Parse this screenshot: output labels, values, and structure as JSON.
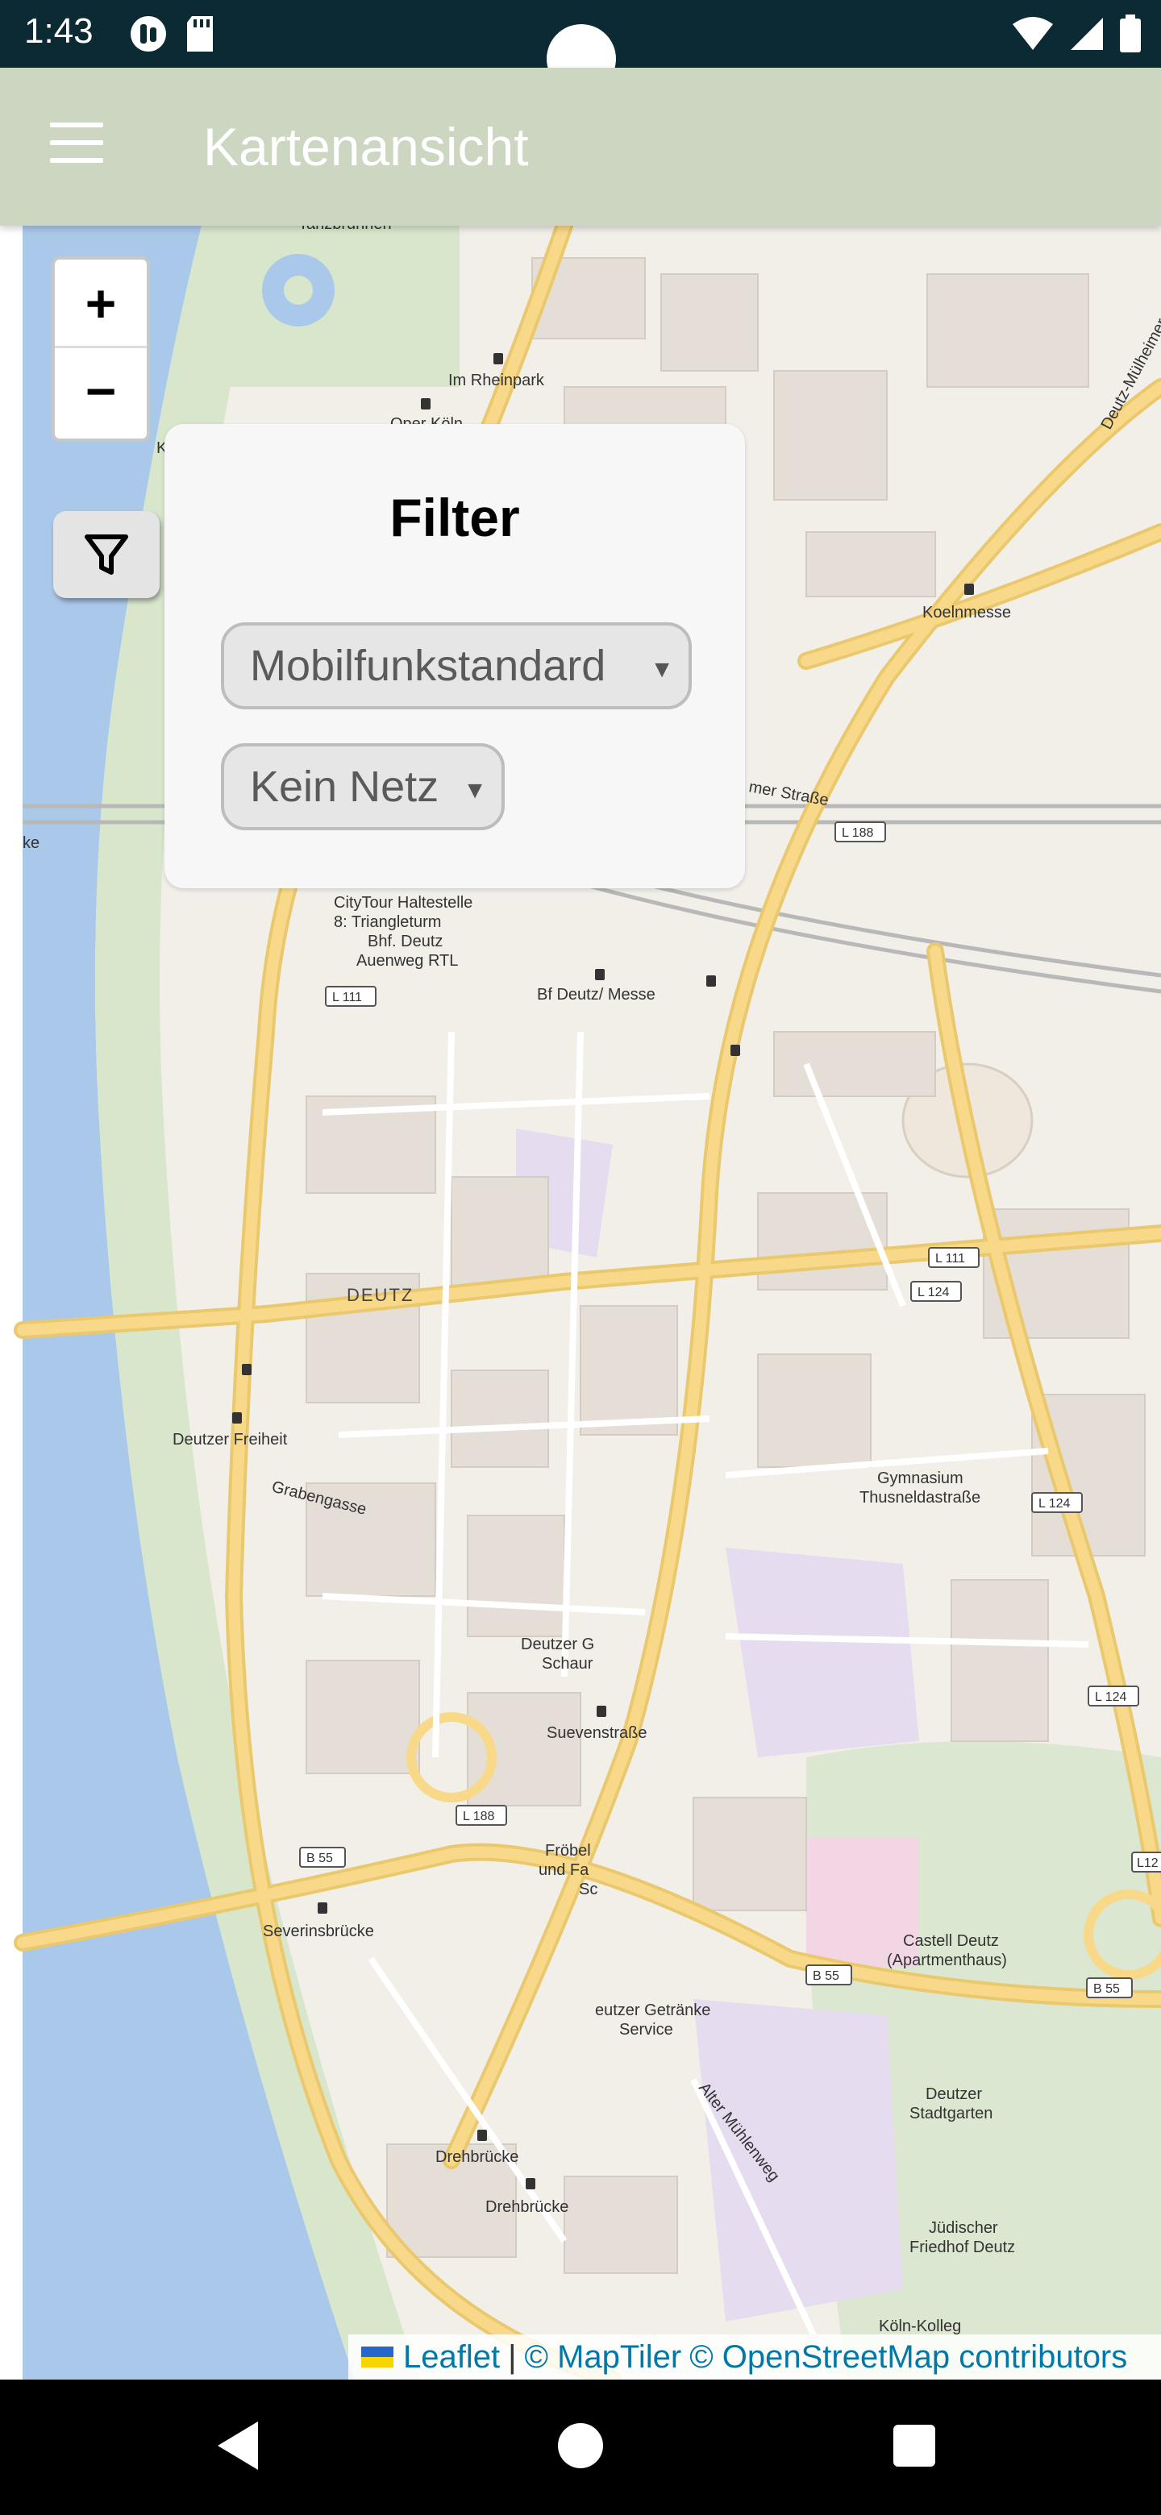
{
  "status_bar": {
    "time": "1:43",
    "icons": [
      "app-icon",
      "sd-card-icon",
      "wifi-icon",
      "cellular-signal-icon",
      "battery-icon"
    ]
  },
  "app_bar": {
    "title": "Kartenansicht",
    "menu_icon": "hamburger-menu-icon"
  },
  "map_controls": {
    "zoom_in": "+",
    "zoom_out": "−",
    "filter_icon": "filter-funnel-icon"
  },
  "filter_panel": {
    "title": "Filter",
    "standard_select": {
      "selected": "Mobilfunkstandard"
    },
    "network_select": {
      "selected": "Kein Netz"
    }
  },
  "attribution": {
    "leaflet": "Leaflet",
    "separator": "|",
    "maptiler": "© MapTiler",
    "osm": "© OpenStreetMap contributors"
  },
  "map_labels": {
    "tanzbrunnen": "Tanzbrunnen",
    "im_rheinpark": "Im Rheinpark",
    "oper_koeln": "Oper Köln",
    "koelnmesse": "Koelnmesse",
    "deutz_muelheimer": "Deutz-Mülheimer Straße",
    "mer_strasse": "mer Straße",
    "citytour_1": "CityTour Haltestelle",
    "citytour_2": "8: Triangleturm",
    "citytour_3": "Bhf. Deutz",
    "citytour_4": "Auenweg RTL",
    "bf_deutz": "Bf Deutz/ Messe",
    "deutz": "DEUTZ",
    "deutzer_freiheit": "Deutzer Freiheit",
    "grabengasse": "Grabengasse",
    "gymnasium_1": "Gymnasium",
    "gymnasium_2": "Thusneldastraße",
    "deutzer_g": "Deutzer G",
    "schaur": "Schaur",
    "suevenstrasse": "Suevenstraße",
    "froebel_1": "Fröbel",
    "froebel_2": "und Fa",
    "froebel_3": "Sc",
    "severinsbruecke": "Severinsbrücke",
    "castell_1": "Castell Deutz",
    "castell_2": "(Apartmenthaus)",
    "getraenke_1": "eutzer Getränke",
    "getraenke_2": "Service",
    "alter_muehlenweg": "Alter Mühlenweg",
    "stadtgarten_1": "Deutzer",
    "stadtgarten_2": "Stadtgarten",
    "drehbruecke_1": "Drehbrücke",
    "drehbruecke_2": "Drehbrücke",
    "friedhof_1": "Jüdischer",
    "friedhof_2": "Friedhof Deutz",
    "koeln_kolleg": "Köln-Kolleg",
    "ke": "ke",
    "k": "K"
  },
  "road_refs": {
    "l188_top": "L 188",
    "l111_left": "L 111",
    "l111_right": "L 111",
    "l124_a": "L 124",
    "l124_b": "L 124",
    "l124_c": "L 124",
    "l188_bottom": "L 188",
    "b55_left": "B 55",
    "b55_mid": "B 55",
    "b55_right": "B 55",
    "l12": "L12"
  },
  "colors": {
    "status_bar": "#0b2a33",
    "app_bar": "#ccd6c0",
    "map_land": "#f2efe9",
    "water": "#aac8ea",
    "road_major": "#f8d98a",
    "park": "#d8e6cc"
  }
}
